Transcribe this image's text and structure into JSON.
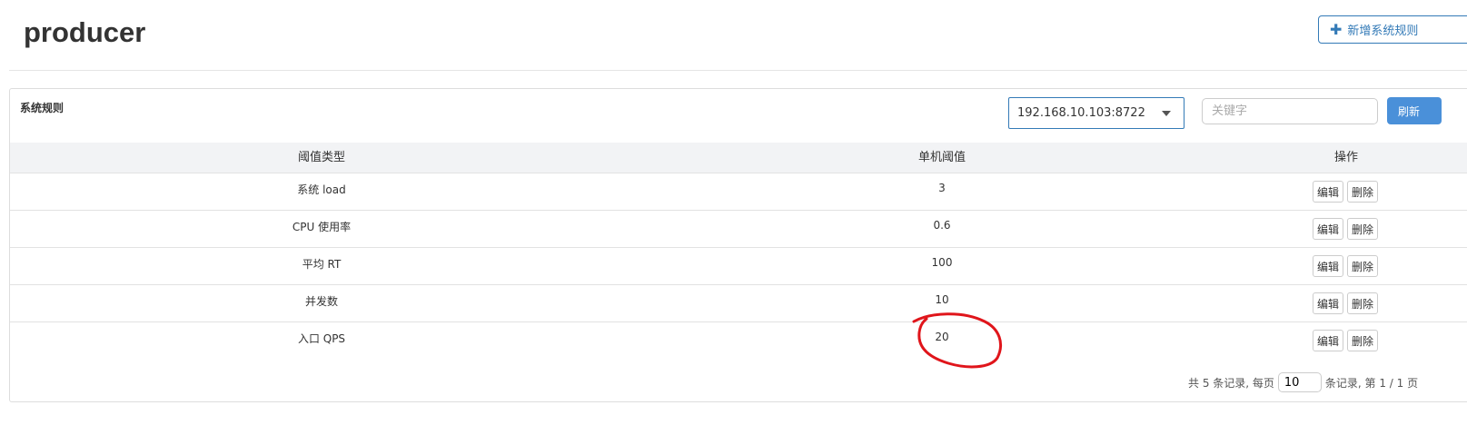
{
  "header": {
    "title": "producer",
    "add_button_label": "新增系统规则",
    "add_icon": "plus-icon"
  },
  "panel": {
    "title": "系统规则",
    "machine_select": {
      "value": "192.168.10.103:8722"
    },
    "search": {
      "placeholder": "关键字",
      "value": ""
    },
    "refresh_label": "刷新"
  },
  "table": {
    "columns": [
      "阈值类型",
      "单机阈值",
      "操作"
    ],
    "rows": [
      {
        "type": "系统 load",
        "threshold": "3",
        "edit": "编辑",
        "delete": "删除"
      },
      {
        "type": "CPU 使用率",
        "threshold": "0.6",
        "edit": "编辑",
        "delete": "删除"
      },
      {
        "type": "平均 RT",
        "threshold": "100",
        "edit": "编辑",
        "delete": "删除"
      },
      {
        "type": "并发数",
        "threshold": "10",
        "edit": "编辑",
        "delete": "删除"
      },
      {
        "type": "入口 QPS",
        "threshold": "20",
        "edit": "编辑",
        "delete": "删除"
      }
    ]
  },
  "pagination": {
    "before": "共 5 条记录, 每页",
    "page_size": "10",
    "after": "条记录, 第 1 / 1 页"
  },
  "annotation": {
    "color": "#e0151b"
  }
}
